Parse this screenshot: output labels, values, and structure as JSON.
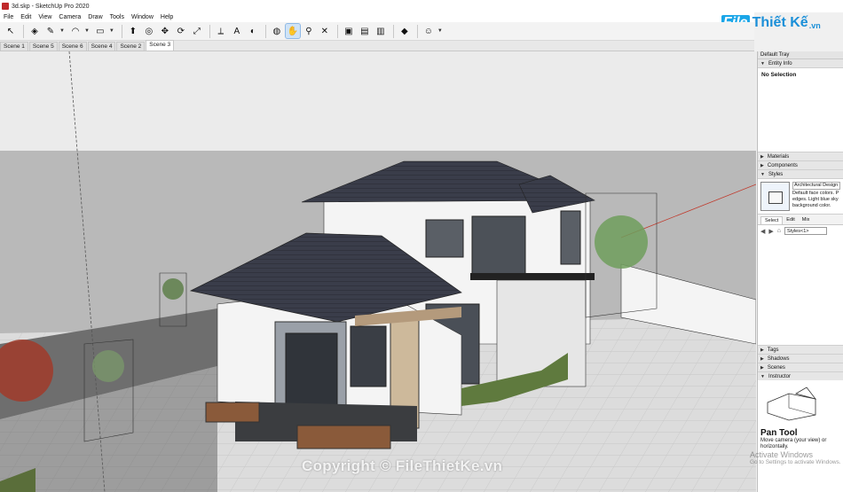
{
  "window": {
    "title": "3d.skp - SketchUp Pro 2020"
  },
  "menu": [
    "File",
    "Edit",
    "View",
    "Camera",
    "Draw",
    "Tools",
    "Window",
    "Help"
  ],
  "brand": {
    "part1": "File",
    "part2": "Thiết Kế",
    "part3": ".vn"
  },
  "toolbar": {
    "tools": [
      {
        "name": "select-tool-icon",
        "glyph": "↖"
      },
      {
        "name": "eraser-tool-icon",
        "glyph": "◈"
      },
      {
        "name": "line-tool-icon",
        "glyph": "✎"
      },
      {
        "name": "arc-tool-icon",
        "glyph": "◠"
      },
      {
        "name": "rectangle-tool-icon",
        "glyph": "▭"
      },
      {
        "name": "push-pull-tool-icon",
        "glyph": "⬆"
      },
      {
        "name": "offset-tool-icon",
        "glyph": "◎"
      },
      {
        "name": "move-tool-icon",
        "glyph": "✥"
      },
      {
        "name": "rotate-tool-icon",
        "glyph": "⟳"
      },
      {
        "name": "scale-tool-icon",
        "glyph": "⤢"
      },
      {
        "name": "tape-measure-tool-icon",
        "glyph": "⟂"
      },
      {
        "name": "text-tool-icon",
        "glyph": "A"
      },
      {
        "name": "paint-bucket-tool-icon",
        "glyph": "◐"
      },
      {
        "name": "orbit-tool-icon",
        "glyph": "◍"
      },
      {
        "name": "pan-tool-icon",
        "glyph": "✋"
      },
      {
        "name": "zoom-tool-icon",
        "glyph": "⚲"
      },
      {
        "name": "zoom-extents-tool-icon",
        "glyph": "✕"
      },
      {
        "name": "warehouse-icon",
        "glyph": "▣"
      },
      {
        "name": "extension-warehouse-icon",
        "glyph": "▤"
      },
      {
        "name": "layout-icon",
        "glyph": "▥"
      },
      {
        "name": "ruby-icon",
        "glyph": "◆"
      },
      {
        "name": "account-icon",
        "glyph": "☺"
      }
    ]
  },
  "scenes": [
    "Scene 1",
    "Scene 5",
    "Scene 6",
    "Scene 4",
    "Scene 2",
    "Scene 3"
  ],
  "active_scene": "Scene 3",
  "tray": {
    "title": "Default Tray",
    "entity_info": {
      "label": "Entity Info",
      "status": "No Selection"
    },
    "materials": "Materials",
    "components": "Components",
    "styles": {
      "label": "Styles",
      "style_name": "Architectural Design S",
      "description": "Default face colors. P edges. Light blue sky background color.",
      "tabs": [
        "Select",
        "Edit",
        "Mix"
      ],
      "selected_collection": "Styles<1>"
    },
    "tags": "Tags",
    "shadows": "Shadows",
    "scenes_panel": "Scenes",
    "instructor": {
      "label": "Instructor",
      "tool_name": "Pan Tool",
      "description": "Move camera (your view) or horizontally."
    }
  },
  "watermarks": {
    "activate_title": "Activate Windows",
    "activate_sub": "Go to Settings to activate Windows.",
    "copyright": "Copyright © FileThietKe.vn"
  },
  "colors": {
    "roof": "#3a3d4a",
    "wall": "#f4f4f4",
    "ground": "#d9d9d9",
    "sky": "#ebebeb",
    "accent_blue": "#1a8fd8"
  }
}
